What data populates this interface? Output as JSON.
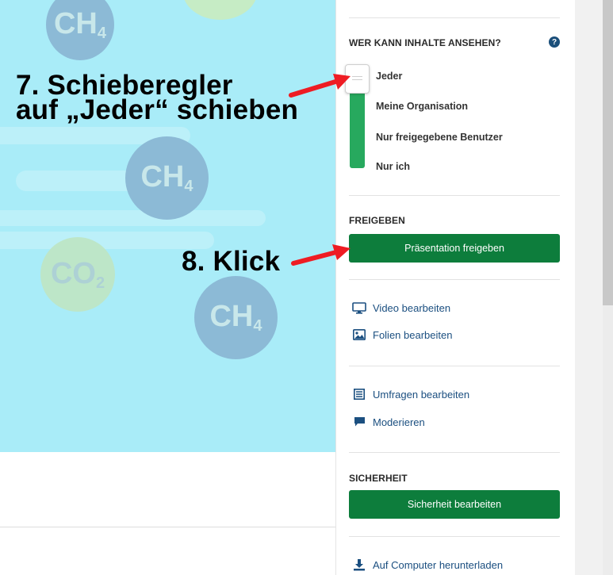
{
  "annotations": {
    "step7_line1": "7. Schieberegler",
    "step7_line2": "auf „Jeder“ schieben",
    "step8": "8. Klick"
  },
  "background_molecules": [
    {
      "formula": "CH",
      "sub": "4"
    },
    {
      "formula": "CH",
      "sub": "4"
    },
    {
      "formula": "CO",
      "sub": "2"
    },
    {
      "formula": "CH",
      "sub": "4"
    }
  ],
  "visibility": {
    "title": "WER KANN INHALTE ANSEHEN?",
    "help_glyph": "?",
    "options": [
      "Jeder",
      "Meine Organisation",
      "Nur freigegebene Benutzer",
      "Nur ich"
    ],
    "selected": "Jeder"
  },
  "share": {
    "title": "FREIGEBEN",
    "button": "Präsentation freigeben"
  },
  "edit_links": [
    "Video bearbeiten",
    "Folien bearbeiten"
  ],
  "engage_links": [
    "Umfragen bearbeiten",
    "Moderieren"
  ],
  "security": {
    "title": "SICHERHEIT",
    "button": "Sicherheit bearbeiten"
  },
  "download_link": "Auf Computer herunterladen",
  "colors": {
    "accent_green": "#0d7d3c",
    "slider_green": "#27a95e",
    "link_blue": "#1b4f80",
    "preview_bg": "#a9ecf8"
  },
  "icons": {
    "help": "question-circle-icon",
    "video": "monitor-icon",
    "slides": "image-icon",
    "polls": "list-icon",
    "moderate": "speech-bubble-icon",
    "download": "download-icon"
  }
}
